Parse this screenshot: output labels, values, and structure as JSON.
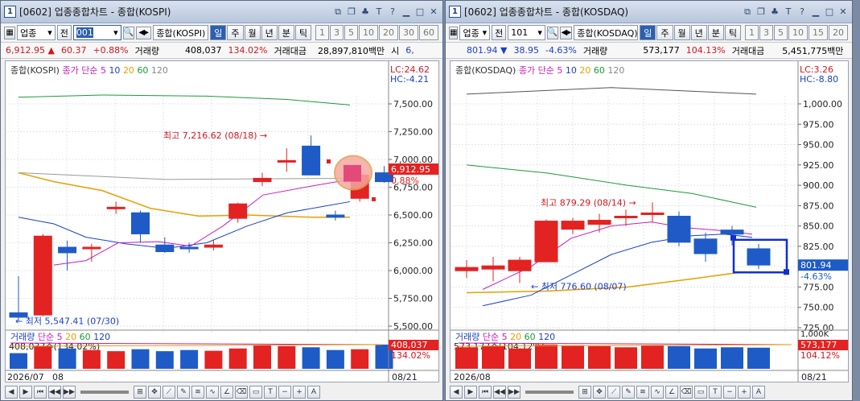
{
  "left": {
    "title": "[0602] 업종종합차트 - 종합(KOSPI)",
    "win_num": "1",
    "toolbar": {
      "kind": "업종",
      "jeon": "전",
      "code": "001",
      "name": "종합(KOSPI)",
      "periods": [
        "일",
        "주",
        "월",
        "년",
        "분",
        "틱"
      ],
      "active_period": "일",
      "nums": [
        "1",
        "3",
        "5",
        "10",
        "20",
        "30",
        "60"
      ]
    },
    "quote": {
      "price": "6,912.95",
      "arrow": "▲",
      "change": "60.37",
      "pct": "+0.88%",
      "vol_label": "거래량",
      "volume": "408,037",
      "vol_pct": "134.02%",
      "amt_label": "거래대금",
      "amount": "28,897,810백만",
      "extra": "시",
      "extra_val": "6,"
    },
    "legend": {
      "name": "종합(KOSPI)",
      "ma_label": "종가 단순",
      "ma": [
        "5",
        "10",
        "20",
        "60",
        "120"
      ]
    },
    "lc": "LC:24.62",
    "hc": "HC:-4.21",
    "yticks": [
      "7,500.00",
      "7,250.00",
      "7,000.00",
      "6,750.00",
      "6,500.00",
      "6,250.00",
      "6,000.00",
      "5,750.00",
      "5,500.00"
    ],
    "high_label": "최고 7,216.62 (08/18)",
    "low_label": "최저 5,547.41 (07/30)",
    "price_tag": "6,912.95",
    "price_tag_pct": "0.88%",
    "vol_legend": {
      "name": "거래량",
      "ma_label": "단순",
      "ma": [
        "5",
        "20",
        "60",
        "120"
      ],
      "value": "408,037주(134.02%)",
      "tag": "408,037",
      "tag_pct": "134.02%"
    },
    "xlabels": [
      "2026/07",
      "08"
    ],
    "date_tag": "08/21",
    "candles": [
      {
        "o": 5620,
        "h": 5950,
        "l": 5547,
        "c": 5580
      },
      {
        "o": 5600,
        "h": 6330,
        "l": 5590,
        "c": 6310
      },
      {
        "o": 6210,
        "h": 6270,
        "l": 6000,
        "c": 6160
      },
      {
        "o": 6200,
        "h": 6240,
        "l": 6080,
        "c": 6210
      },
      {
        "o": 6560,
        "h": 6620,
        "l": 6510,
        "c": 6570
      },
      {
        "o": 6520,
        "h": 6540,
        "l": 6250,
        "c": 6330
      },
      {
        "o": 6230,
        "h": 6300,
        "l": 6160,
        "c": 6170
      },
      {
        "o": 6210,
        "h": 6250,
        "l": 6160,
        "c": 6200
      },
      {
        "o": 6210,
        "h": 6280,
        "l": 6180,
        "c": 6230
      },
      {
        "o": 6470,
        "h": 6610,
        "l": 6430,
        "c": 6600
      },
      {
        "o": 6800,
        "h": 6880,
        "l": 6760,
        "c": 6830
      },
      {
        "o": 6990,
        "h": 7100,
        "l": 6890,
        "c": 6990
      },
      {
        "o": 7120,
        "h": 7216,
        "l": 6860,
        "c": 6860
      },
      {
        "o": 6500,
        "h": 6540,
        "l": 6450,
        "c": 6480
      },
      {
        "o": 6650,
        "h": 6880,
        "l": 6620,
        "c": 6860
      },
      {
        "o": 6880,
        "h": 6940,
        "l": 6790,
        "c": 6800
      }
    ],
    "vols": [
      40,
      58,
      52,
      48,
      45,
      50,
      45,
      48,
      46,
      52,
      60,
      58,
      55,
      48,
      50,
      62
    ]
  },
  "right": {
    "title": "[0602] 업종종합차트 - 종합(KOSDAQ)",
    "win_num": "1",
    "toolbar": {
      "kind": "업종",
      "jeon": "전",
      "code": "101",
      "name": "종합(KOSDAQ)",
      "periods": [
        "일",
        "주",
        "월",
        "년",
        "분",
        "틱"
      ],
      "active_period": "일",
      "nums": [
        "1",
        "3",
        "5",
        "10",
        "15",
        "20"
      ]
    },
    "quote": {
      "price": "801.94",
      "arrow": "▼",
      "change": "38.95",
      "pct": "-4.63%",
      "vol_label": "거래량",
      "volume": "573,177",
      "vol_pct": "104.13%",
      "amt_label": "거래대금",
      "amount": "5,451,775백만"
    },
    "legend": {
      "name": "종합(KOSDAQ)",
      "ma_label": "종가 단순",
      "ma": [
        "5",
        "10",
        "20",
        "60",
        "120"
      ]
    },
    "lc": "LC:3.26",
    "hc": "HC:-8.80",
    "yticks": [
      "1,000.00",
      "975.00",
      "950.00",
      "925.00",
      "900.00",
      "875.00",
      "850.00",
      "825.00",
      "800.00",
      "775.00",
      "750.00",
      "725.00"
    ],
    "high_label": "최고 879.29 (08/14)",
    "low_label": "최저 776.60 (08/07)",
    "price_tag": "801.94",
    "price_tag_pct": "-4.63%",
    "vol_legend": {
      "name": "거래량",
      "ma_label": "단순",
      "ma": [
        "5",
        "20",
        "60",
        "120"
      ],
      "value": "573,177주(104.12%)",
      "tag": "1,000K",
      "tag2": "573,177",
      "tag_pct": "104.12%"
    },
    "xlabels": [
      "2026/08"
    ],
    "date_tag": "08/21",
    "candles": [
      {
        "o": 795,
        "h": 808,
        "l": 786,
        "c": 799
      },
      {
        "o": 797,
        "h": 812,
        "l": 782,
        "c": 801
      },
      {
        "o": 795,
        "h": 812,
        "l": 780,
        "c": 808
      },
      {
        "o": 806,
        "h": 858,
        "l": 806,
        "c": 856
      },
      {
        "o": 846,
        "h": 860,
        "l": 840,
        "c": 856
      },
      {
        "o": 852,
        "h": 865,
        "l": 842,
        "c": 857
      },
      {
        "o": 860,
        "h": 870,
        "l": 850,
        "c": 862
      },
      {
        "o": 864,
        "h": 879,
        "l": 855,
        "c": 866
      },
      {
        "o": 862,
        "h": 868,
        "l": 825,
        "c": 830
      },
      {
        "o": 834,
        "h": 842,
        "l": 806,
        "c": 816
      },
      {
        "o": 845,
        "h": 850,
        "l": 826,
        "c": 840
      },
      {
        "o": 822,
        "h": 828,
        "l": 797,
        "c": 802
      }
    ],
    "vols": [
      55,
      58,
      52,
      62,
      60,
      58,
      55,
      60,
      58,
      52,
      55,
      54
    ]
  }
}
